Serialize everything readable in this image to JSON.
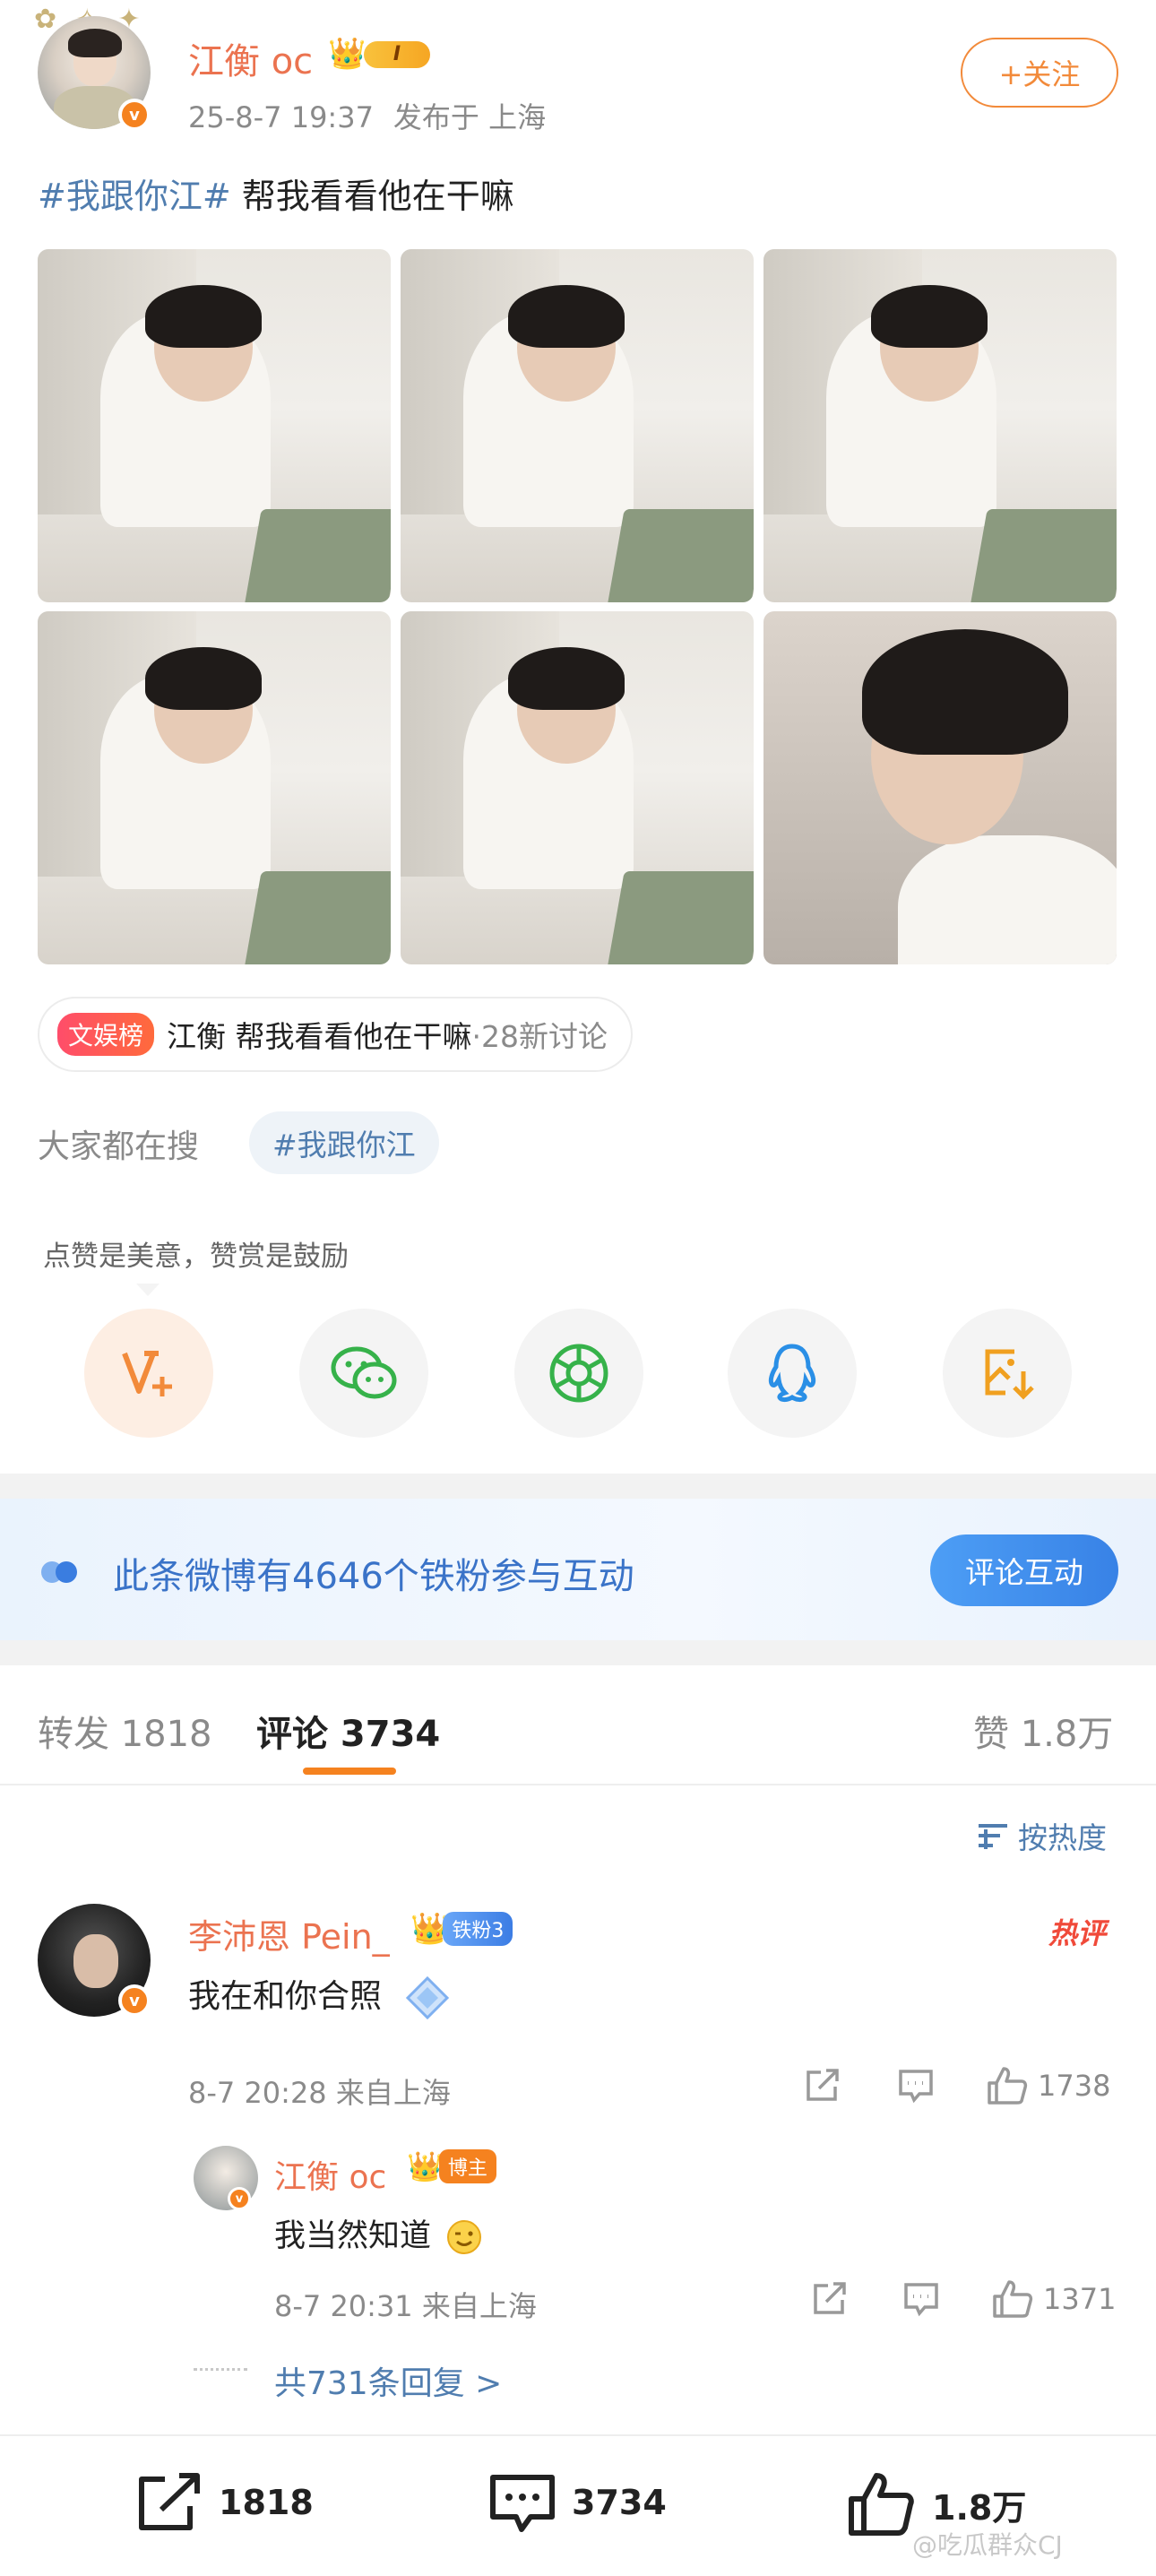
{
  "post": {
    "author": "江衡 oc",
    "level_badge": "I",
    "time": "25-8-7 19:37",
    "location": "发布于 上海",
    "follow_label": "+关注",
    "hashtag": "#我跟你江#",
    "text": "帮我看看他在干嘛",
    "photos": 6
  },
  "topic": {
    "badge": "文娱榜",
    "title": "江衡 帮我看看他在干嘛",
    "count": "·28新讨论"
  },
  "search": {
    "label": "大家都在搜",
    "chip": "#我跟你江"
  },
  "reward": {
    "tip": "点赞是美意，赞赏是鼓励",
    "share_icons": [
      "reward-icon",
      "wechat-icon",
      "moments-icon",
      "qq-icon",
      "save-image-icon"
    ]
  },
  "fans": {
    "text": "此条微博有4646个铁粉参与互动",
    "button": "评论互动"
  },
  "tabs": {
    "repost": "转发 1818",
    "comment": "评论 3734",
    "like": "赞 1.8万"
  },
  "sort_label": "按热度",
  "comment": {
    "name": "李沛恩 Pein_",
    "fan_badge": "铁粉3",
    "hot": "热评",
    "text": "我在和你合照",
    "meta": "8-7 20:28 来自上海",
    "likes": "1738"
  },
  "reply": {
    "name": "江衡 oc",
    "badge": "博主",
    "text": "我当然知道",
    "meta": "8-7 20:31 来自上海",
    "likes": "1371",
    "more": "共731条回复 >"
  },
  "bottom": {
    "repost": "1818",
    "comment": "3734",
    "like": "1.8万"
  },
  "watermark": "@吃瓜群众CJ",
  "colors": {
    "accent_orange": "#f5821f",
    "name_orange": "#eb7350",
    "link_blue": "#507daf"
  }
}
